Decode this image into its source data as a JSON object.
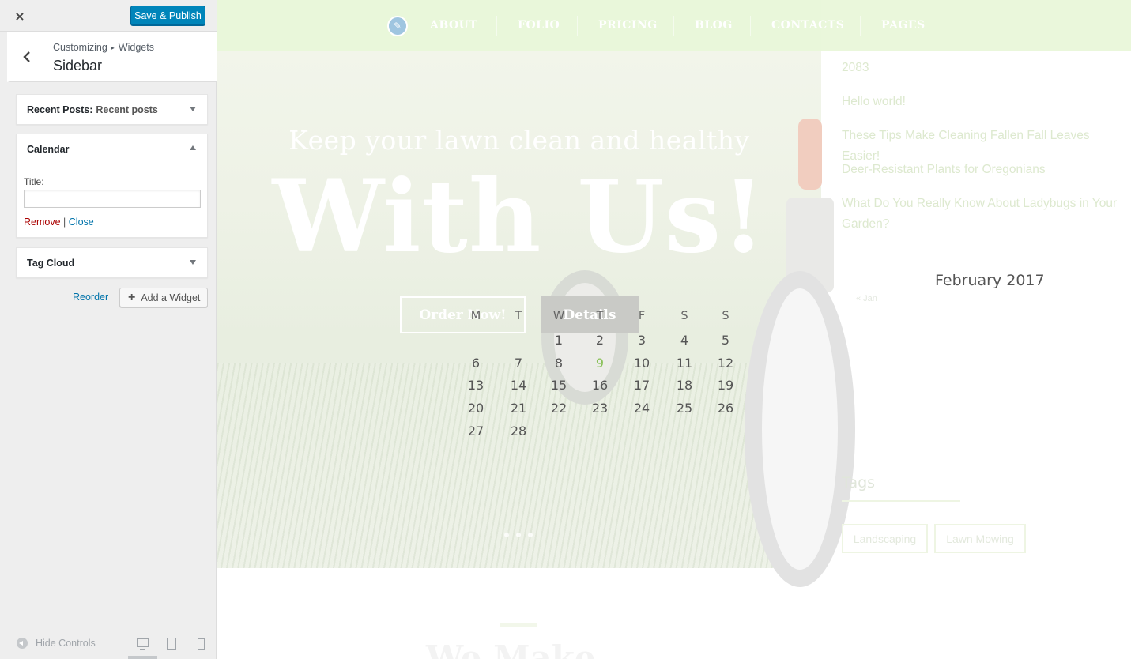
{
  "customizer": {
    "close_label": "×",
    "publish_label": "Save & Publish",
    "breadcrumb": [
      "Customizing",
      "Widgets"
    ],
    "breadcrumb_sep": "▸",
    "section_title": "Sidebar",
    "widgets": [
      {
        "name": "Recent Posts:",
        "sub": "Recent posts",
        "expanded": false
      },
      {
        "name": "Calendar",
        "sub": "",
        "expanded": true
      },
      {
        "name": "Tag Cloud",
        "sub": "",
        "expanded": false
      }
    ],
    "calendar_form": {
      "title_label": "Title:",
      "title_value": "",
      "remove_label": "Remove",
      "separator": "|",
      "close_label": "Close"
    },
    "reorder_label": "Reorder",
    "add_widget_label": "Add a Widget",
    "hide_controls_label": "Hide Controls",
    "devices": [
      "desktop-icon",
      "tablet-icon",
      "mobile-icon"
    ]
  },
  "preview": {
    "nav": [
      "ABOUT",
      "FOLIO",
      "PRICING",
      "BLOG",
      "CONTACTS",
      "PAGES"
    ],
    "hero": {
      "subtitle": "Keep your lawn clean and healthy",
      "title": "With Us!",
      "primary_button": "Order Now!",
      "secondary_button": "Details"
    },
    "recent_posts": [
      "2083",
      "Hello world!",
      "These Tips Make Cleaning Fallen Fall Leaves Easier!",
      "Deer-Resistant Plants for Oregonians",
      "What Do You Really Know About Ladybugs in Your Garden?"
    ],
    "calendar": {
      "caption": "February 2017",
      "prev_label": "« Jan",
      "weekdays": [
        "M",
        "T",
        "W",
        "T",
        "F",
        "S",
        "S"
      ],
      "rows": [
        [
          "",
          "",
          "1",
          "2",
          "3",
          "4",
          "5"
        ],
        [
          "6",
          "7",
          "8",
          "9",
          "10",
          "11",
          "12"
        ],
        [
          "13",
          "14",
          "15",
          "16",
          "17",
          "18",
          "19"
        ],
        [
          "20",
          "21",
          "22",
          "23",
          "24",
          "25",
          "26"
        ],
        [
          "27",
          "28",
          "",
          "",
          "",
          "",
          ""
        ]
      ],
      "today": "9"
    },
    "tags_title": "Tags",
    "tags": [
      "Landscaping",
      "Lawn Mowing"
    ],
    "below_heading": "We Make"
  },
  "colors": {
    "publish": "#0085ba",
    "link": "#0073aa",
    "remove": "#aa0000",
    "today": "#88c057",
    "nav_bg": "#e8f6d8"
  }
}
